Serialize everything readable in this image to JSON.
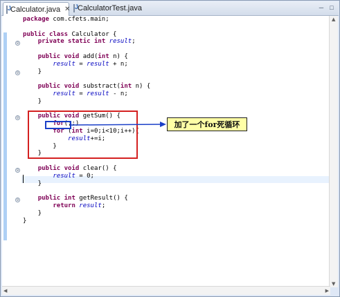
{
  "tabs": [
    {
      "label": "Calculator.java",
      "icon": "java-file-icon",
      "active": true,
      "close": "✕"
    },
    {
      "label": "CalculatorTest.java",
      "icon": "java-file-icon",
      "active": false
    }
  ],
  "window_buttons": {
    "minimize": "─",
    "maximize": "□"
  },
  "code_lines": [
    [
      {
        "t": "package",
        "c": "kw"
      },
      {
        "t": " com.cfets.main;"
      }
    ],
    [
      {
        "t": ""
      }
    ],
    [
      {
        "t": "public",
        "c": "kw"
      },
      {
        "t": " "
      },
      {
        "t": "class",
        "c": "kw"
      },
      {
        "t": " Calculator {"
      }
    ],
    [
      {
        "t": "    "
      },
      {
        "t": "private",
        "c": "kw"
      },
      {
        "t": " "
      },
      {
        "t": "static",
        "c": "kw"
      },
      {
        "t": " "
      },
      {
        "t": "int",
        "c": "kw"
      },
      {
        "t": " "
      },
      {
        "t": "result",
        "c": "it"
      },
      {
        "t": ";"
      }
    ],
    [
      {
        "t": ""
      }
    ],
    [
      {
        "t": "    "
      },
      {
        "t": "public",
        "c": "kw"
      },
      {
        "t": " "
      },
      {
        "t": "void",
        "c": "kw"
      },
      {
        "t": " add("
      },
      {
        "t": "int",
        "c": "kw"
      },
      {
        "t": " n) {"
      }
    ],
    [
      {
        "t": "        "
      },
      {
        "t": "result",
        "c": "it"
      },
      {
        "t": " = "
      },
      {
        "t": "result",
        "c": "it"
      },
      {
        "t": " + n;"
      }
    ],
    [
      {
        "t": "    }"
      }
    ],
    [
      {
        "t": ""
      }
    ],
    [
      {
        "t": "    "
      },
      {
        "t": "public",
        "c": "kw"
      },
      {
        "t": " "
      },
      {
        "t": "void",
        "c": "kw"
      },
      {
        "t": " substract("
      },
      {
        "t": "int",
        "c": "kw"
      },
      {
        "t": " n) {"
      }
    ],
    [
      {
        "t": "        "
      },
      {
        "t": "result",
        "c": "it"
      },
      {
        "t": " = "
      },
      {
        "t": "result",
        "c": "it"
      },
      {
        "t": " - n;"
      }
    ],
    [
      {
        "t": "    }"
      }
    ],
    [
      {
        "t": ""
      }
    ],
    [
      {
        "t": "    "
      },
      {
        "t": "public",
        "c": "kw"
      },
      {
        "t": " "
      },
      {
        "t": "void",
        "c": "kw"
      },
      {
        "t": " getSum() {"
      }
    ],
    [
      {
        "t": "        "
      },
      {
        "t": "for",
        "c": "kw"
      },
      {
        "t": "(;;)"
      }
    ],
    [
      {
        "t": "        "
      },
      {
        "t": "for",
        "c": "kw"
      },
      {
        "t": " ("
      },
      {
        "t": "int",
        "c": "kw"
      },
      {
        "t": " i=0;i<10;i++){"
      }
    ],
    [
      {
        "t": "            "
      },
      {
        "t": "result",
        "c": "it"
      },
      {
        "t": "+=i;"
      }
    ],
    [
      {
        "t": "        }"
      }
    ],
    [
      {
        "t": "    }"
      }
    ],
    [
      {
        "t": ""
      }
    ],
    [
      {
        "t": "    "
      },
      {
        "t": "public",
        "c": "kw"
      },
      {
        "t": " "
      },
      {
        "t": "void",
        "c": "kw"
      },
      {
        "t": " clear() {"
      }
    ],
    [
      {
        "t": "        "
      },
      {
        "t": "result",
        "c": "it"
      },
      {
        "t": " = 0;"
      }
    ],
    [
      {
        "t": "    }"
      }
    ],
    [
      {
        "t": ""
      }
    ],
    [
      {
        "t": "    "
      },
      {
        "t": "public",
        "c": "kw"
      },
      {
        "t": " "
      },
      {
        "t": "int",
        "c": "kw"
      },
      {
        "t": " getResult() {"
      }
    ],
    [
      {
        "t": "        "
      },
      {
        "t": "return",
        "c": "kw"
      },
      {
        "t": " "
      },
      {
        "t": "result",
        "c": "it"
      },
      {
        "t": ";"
      }
    ],
    [
      {
        "t": "    }"
      }
    ],
    [
      {
        "t": "}"
      }
    ]
  ],
  "fold_markers": [
    "⊖",
    "⊖",
    "⊖",
    "⊖",
    "⊖"
  ],
  "annotation": {
    "callout_text": "加了一个for死循环"
  },
  "colors": {
    "keyword": "#7f0055",
    "field": "#0000c0",
    "highlight_box": "#d42020",
    "arrow": "#1a3fc8",
    "callout_bg": "#ffffa6"
  }
}
